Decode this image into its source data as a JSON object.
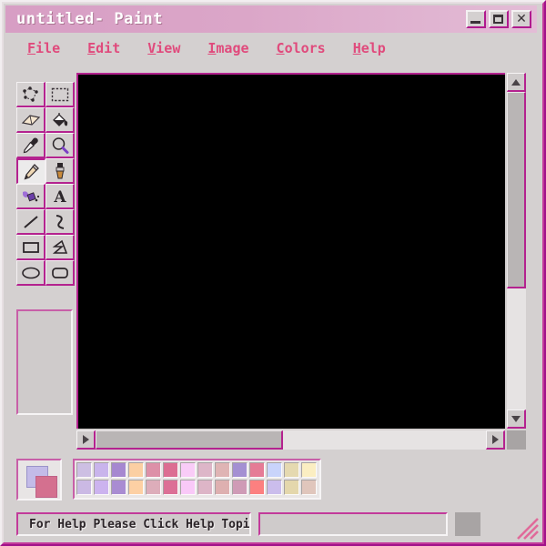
{
  "window": {
    "title": "untitled- Paint",
    "buttons": [
      {
        "name": "minimize",
        "label": "_"
      },
      {
        "name": "maximize",
        "label": "□"
      },
      {
        "name": "close",
        "label": "✕"
      }
    ]
  },
  "menubar": {
    "items": [
      {
        "acc": "F",
        "rest": "ile"
      },
      {
        "acc": "E",
        "rest": "dit"
      },
      {
        "acc": "V",
        "rest": "iew"
      },
      {
        "acc": "I",
        "rest": "mage"
      },
      {
        "acc": "C",
        "rest": "olors"
      },
      {
        "acc": "H",
        "rest": "elp"
      }
    ]
  },
  "toolbox": {
    "tools": [
      {
        "name": "free-form-select-tool",
        "icon": "free-form-select-icon",
        "selected": false
      },
      {
        "name": "rectangle-select-tool",
        "icon": "rectangle-select-icon",
        "selected": false
      },
      {
        "name": "eraser-tool",
        "icon": "eraser-icon",
        "selected": false
      },
      {
        "name": "fill-tool",
        "icon": "paint-bucket-icon",
        "selected": false
      },
      {
        "name": "color-picker-tool",
        "icon": "eyedropper-icon",
        "selected": false
      },
      {
        "name": "magnifier-tool",
        "icon": "magnifier-icon",
        "selected": false
      },
      {
        "name": "pencil-tool",
        "icon": "pencil-icon",
        "selected": true
      },
      {
        "name": "brush-tool",
        "icon": "brush-icon",
        "selected": false
      },
      {
        "name": "airbrush-tool",
        "icon": "airbrush-icon",
        "selected": false
      },
      {
        "name": "text-tool",
        "icon": "text-a-icon",
        "selected": false
      },
      {
        "name": "line-tool",
        "icon": "line-icon",
        "selected": false
      },
      {
        "name": "curve-tool",
        "icon": "curve-icon",
        "selected": false
      },
      {
        "name": "rectangle-tool",
        "icon": "rectangle-icon",
        "selected": false
      },
      {
        "name": "polygon-tool",
        "icon": "polygon-icon",
        "selected": false
      },
      {
        "name": "ellipse-tool",
        "icon": "ellipse-icon",
        "selected": false
      },
      {
        "name": "rounded-rectangle-tool",
        "icon": "rounded-rectangle-icon",
        "selected": false
      }
    ]
  },
  "canvas": {
    "color": "#000000"
  },
  "scrollbars": {
    "vertical": {
      "thumb_top_pct": 0,
      "thumb_height_pct": 62
    },
    "horizontal": {
      "thumb_left_pct": 0,
      "thumb_width_pct": 48
    }
  },
  "palette": {
    "foreground_color": "#d4708f",
    "background_color": "#c3bbe8",
    "swatches_row1": [
      "#cdbfe3",
      "#c9b4ec",
      "#a688d0",
      "#fbcfa3",
      "#dd90a8",
      "#dc6e92",
      "#f9ccf7",
      "#ddb6c8",
      "#dfb4b4",
      "#a490d2",
      "#e57b96",
      "#c9d4fb",
      "#e5d9b0",
      "#fbeec2"
    ],
    "swatches_row2": [
      "#cbb9e4",
      "#ccb3ef",
      "#a98cd2",
      "#fdd0a4",
      "#ddadba",
      "#dc7096",
      "#f9c9f8",
      "#ddb5c7",
      "#deb0b0",
      "#cf9bb6",
      "#fc8080",
      "#cbbdec",
      "#e4d7ac",
      "#e0c6bc"
    ]
  },
  "statusbar": {
    "help_text": "For Help Please Click Help Topic",
    "secondary_text": "",
    "tertiary_text": ""
  }
}
